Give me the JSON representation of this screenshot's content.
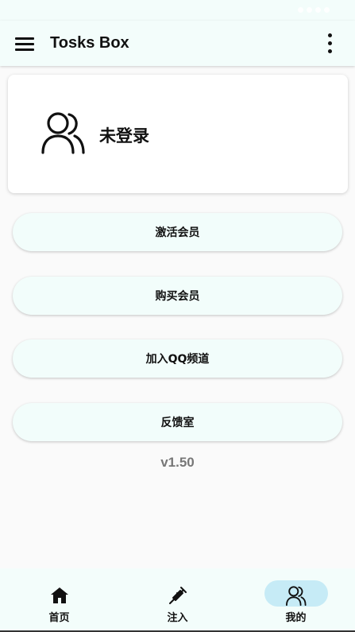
{
  "app_bar": {
    "title": "Tosks Box",
    "menu_icon": "hamburger-menu-icon",
    "more_icon": "more-vertical-icon"
  },
  "profile": {
    "avatar_icon": "users-icon",
    "status": "未登录"
  },
  "actions": [
    {
      "label": "激活会员"
    },
    {
      "label": "购买会员"
    },
    {
      "label": "加入QQ频道"
    },
    {
      "label": "反馈室"
    }
  ],
  "version": "v1.50",
  "bottom_nav": {
    "items": [
      {
        "label": "首页",
        "icon": "home-icon",
        "active": false
      },
      {
        "label": "注入",
        "icon": "syringe-icon",
        "active": false
      },
      {
        "label": "我的",
        "icon": "users-icon",
        "active": true
      }
    ]
  },
  "colors": {
    "app_bar_bg": "#f3fdfb",
    "page_bg": "#fafafa",
    "button_bg": "#f2fdfb",
    "active_indicator": "#c6ebf6",
    "version_text": "#777777"
  }
}
